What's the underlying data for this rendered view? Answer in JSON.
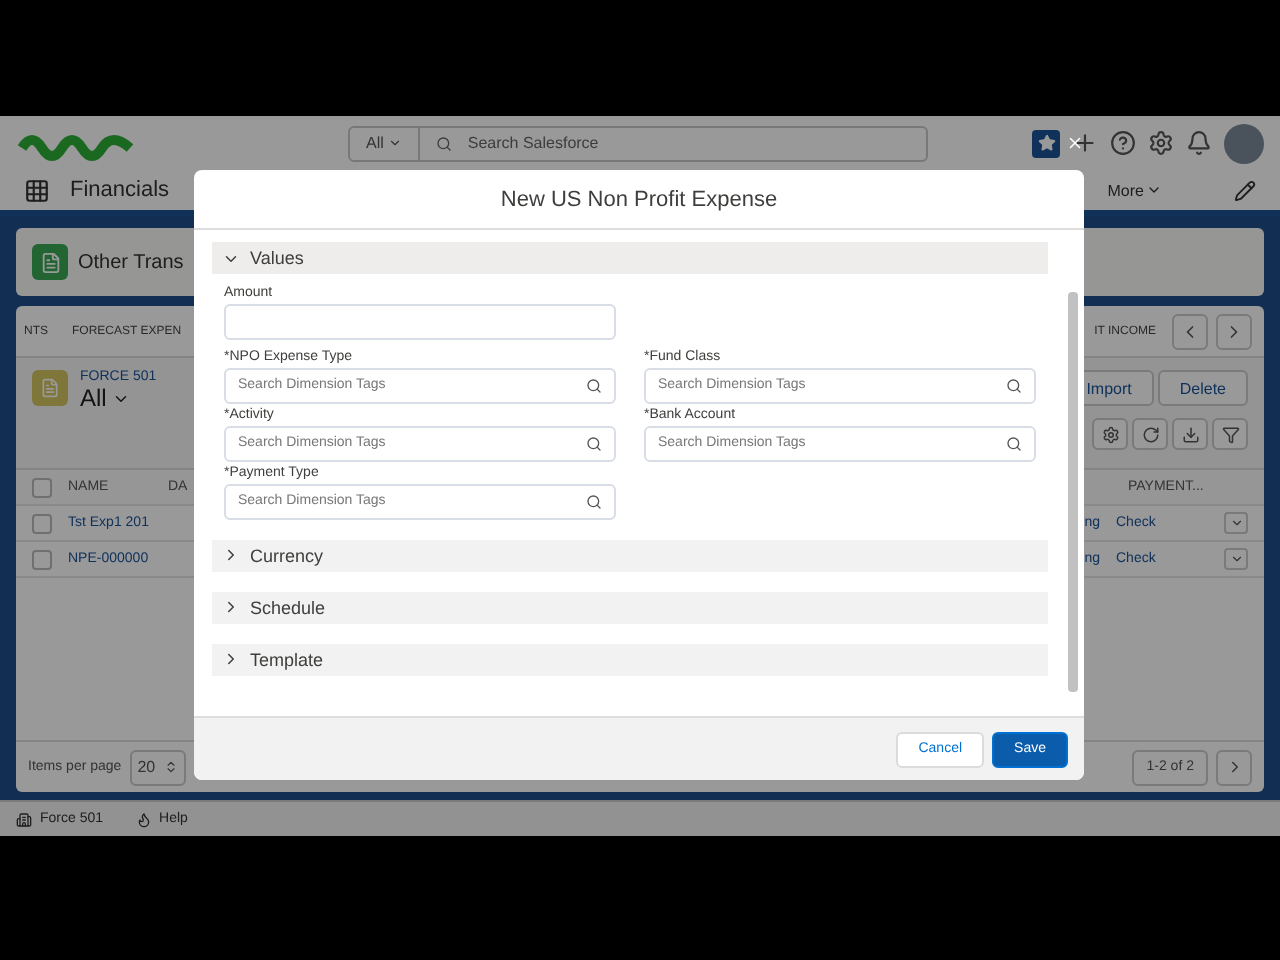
{
  "header": {
    "search_scope": "All",
    "search_placeholder": "Search Salesforce"
  },
  "nav": {
    "app_name": "Financials",
    "more": "More"
  },
  "page": {
    "title": "Other Trans",
    "tabs_left": [
      "NTS",
      "FORECAST EXPEN"
    ],
    "tabs_right": [
      "IT INCOME"
    ],
    "list_label": "FORCE 501",
    "list_view": "All",
    "buttons": [
      "Import",
      "Delete"
    ],
    "columns_left": [
      "NAME",
      "DA"
    ],
    "columns_right": [
      "PAYMENT..."
    ],
    "all_checked": false,
    "rows": [
      {
        "name": "Tst Exp1 201",
        "status": "ng",
        "payment": "Check",
        "checked": false
      },
      {
        "name": "NPE-000000",
        "status": "ng",
        "payment": "Check",
        "checked": false
      }
    ],
    "items_per_page_label": "Items per page",
    "items_per_page": "20",
    "range": "1-2 of 2"
  },
  "utility_bar": [
    "Force 501",
    "Help"
  ],
  "modal": {
    "title": "New US Non Profit Expense",
    "sections": [
      {
        "title": "Values",
        "expanded": true
      },
      {
        "title": "Currency",
        "expanded": false
      },
      {
        "title": "Schedule",
        "expanded": false
      },
      {
        "title": "Template",
        "expanded": false
      }
    ],
    "amount_label": "Amount",
    "fields": [
      {
        "label": "*NPO Expense Type",
        "placeholder": "Search Dimension Tags"
      },
      {
        "label": "*Fund Class",
        "placeholder": "Search Dimension Tags"
      },
      {
        "label": "*Activity",
        "placeholder": "Search Dimension Tags"
      },
      {
        "label": "*Bank Account",
        "placeholder": "Search Dimension Tags"
      },
      {
        "label": "*Payment Type",
        "placeholder": "Search Dimension Tags"
      }
    ],
    "buttons": [
      {
        "label": "Cancel",
        "kind": "neutral"
      },
      {
        "label": "Save",
        "kind": "brand"
      }
    ]
  }
}
